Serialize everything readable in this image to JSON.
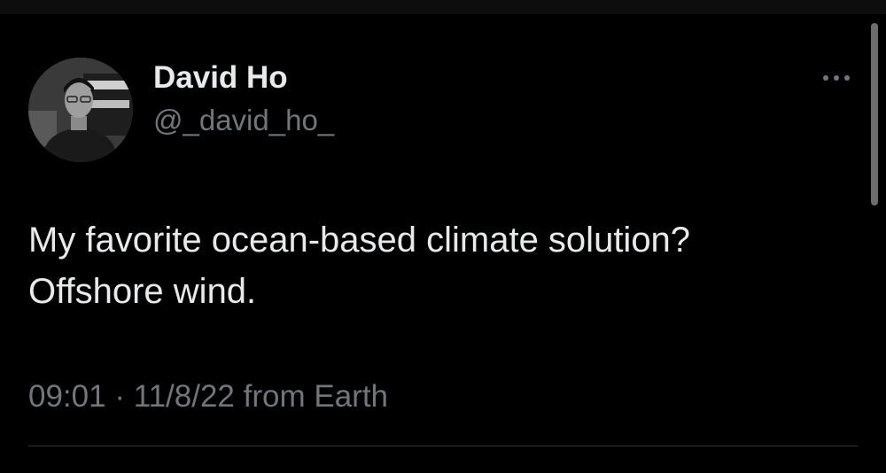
{
  "tweet": {
    "author": {
      "display_name": "David Ho",
      "handle": "@_david_ho_",
      "avatar_icon": "profile-photo"
    },
    "more_icon": "more-horizontal-icon",
    "text_lines": [
      "My favorite ocean-based climate solution?",
      "Offshore wind."
    ],
    "meta": {
      "time": "09:01",
      "separator": "·",
      "date": "11/8/22",
      "source": "from Earth"
    }
  },
  "colors": {
    "background": "#000000",
    "primary_text": "#e7e9ea",
    "secondary_text": "#71767b",
    "divider": "#2f3336"
  }
}
